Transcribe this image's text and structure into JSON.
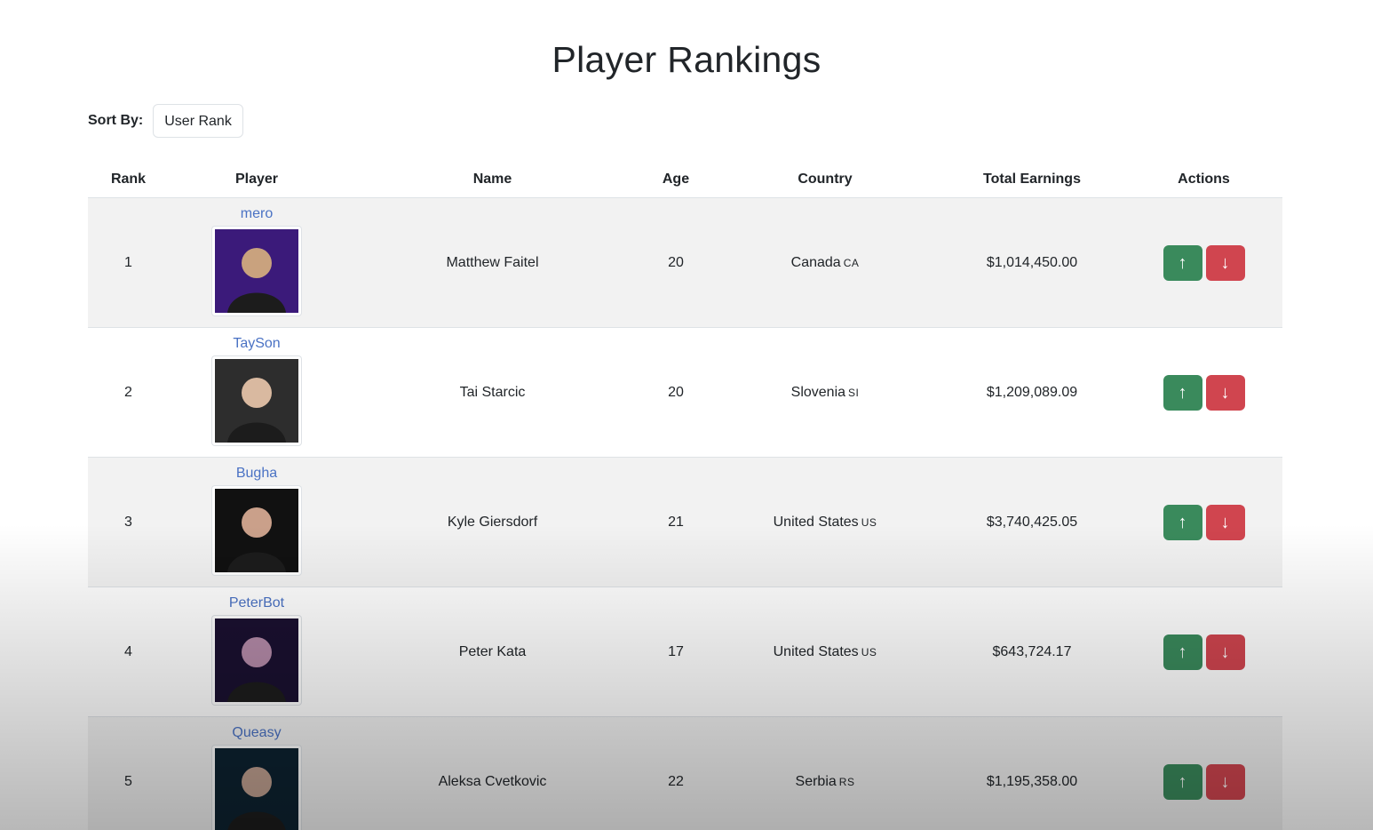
{
  "page": {
    "title": "Player Rankings"
  },
  "sort": {
    "label": "Sort By:",
    "selected": "User Rank"
  },
  "table": {
    "headers": [
      "Rank",
      "Player",
      "Name",
      "Age",
      "Country",
      "Total Earnings",
      "Actions"
    ],
    "rows": [
      {
        "rank": "1",
        "tag": "mero",
        "name": "Matthew Faitel",
        "age": "20",
        "country": "Canada",
        "code": "CA",
        "earnings": "$1,014,450.00"
      },
      {
        "rank": "2",
        "tag": "TaySon",
        "name": "Tai Starcic",
        "age": "20",
        "country": "Slovenia",
        "code": "SI",
        "earnings": "$1,209,089.09"
      },
      {
        "rank": "3",
        "tag": "Bugha",
        "name": "Kyle Giersdorf",
        "age": "21",
        "country": "United States",
        "code": "US",
        "earnings": "$3,740,425.05"
      },
      {
        "rank": "4",
        "tag": "PeterBot",
        "name": "Peter Kata",
        "age": "17",
        "country": "United States",
        "code": "US",
        "earnings": "$643,724.17"
      },
      {
        "rank": "5",
        "tag": "Queasy",
        "name": "Aleksa Cvetkovic",
        "age": "22",
        "country": "Serbia",
        "code": "RS",
        "earnings": "$1,195,358.00"
      }
    ]
  },
  "actions": {
    "up_icon": "arrow-up-icon",
    "up_glyph": "↑",
    "down_icon": "arrow-down-icon",
    "down_glyph": "↓"
  },
  "colors": {
    "up": "#3a8a5c",
    "down": "#d0454f",
    "link": "#4a72c4",
    "stripe": "#f2f2f2"
  }
}
